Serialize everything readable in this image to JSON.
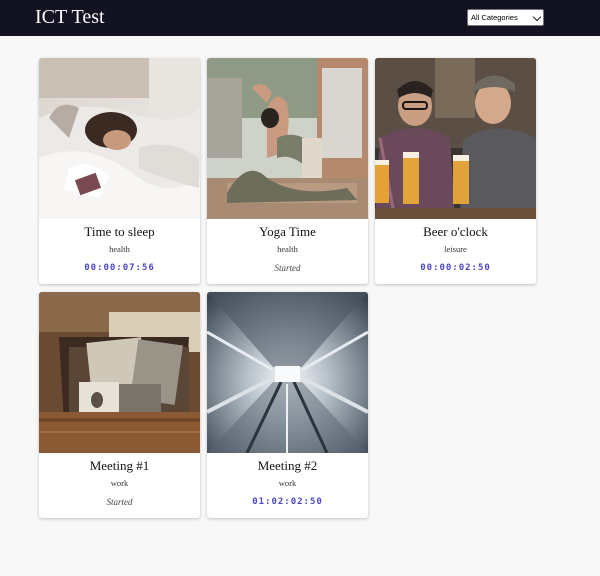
{
  "header": {
    "title": "ICT Test",
    "category_filter": "All Categories"
  },
  "activities": [
    {
      "title": "Time to sleep",
      "category": "health",
      "status": "00:00:07:56",
      "image": "sleeping-person-photo"
    },
    {
      "title": "Yoga Time",
      "category": "health",
      "status": "Started",
      "image": "yoga-pose-photo"
    },
    {
      "title": "Beer o'clock",
      "category": "leisure",
      "status": "00:00:02:50",
      "image": "two-men-with-beer-photo"
    },
    {
      "title": "Meeting #1",
      "category": "work",
      "status": "Started",
      "image": "old-photos-box-photo"
    },
    {
      "title": "Meeting #2",
      "category": "work",
      "status": "01:02:02:50",
      "image": "tunnel-motion-photo"
    }
  ],
  "colors": {
    "header_bg": "#121222",
    "timer_text": "#4a46c8",
    "page_bg": "#f8f8f8"
  }
}
